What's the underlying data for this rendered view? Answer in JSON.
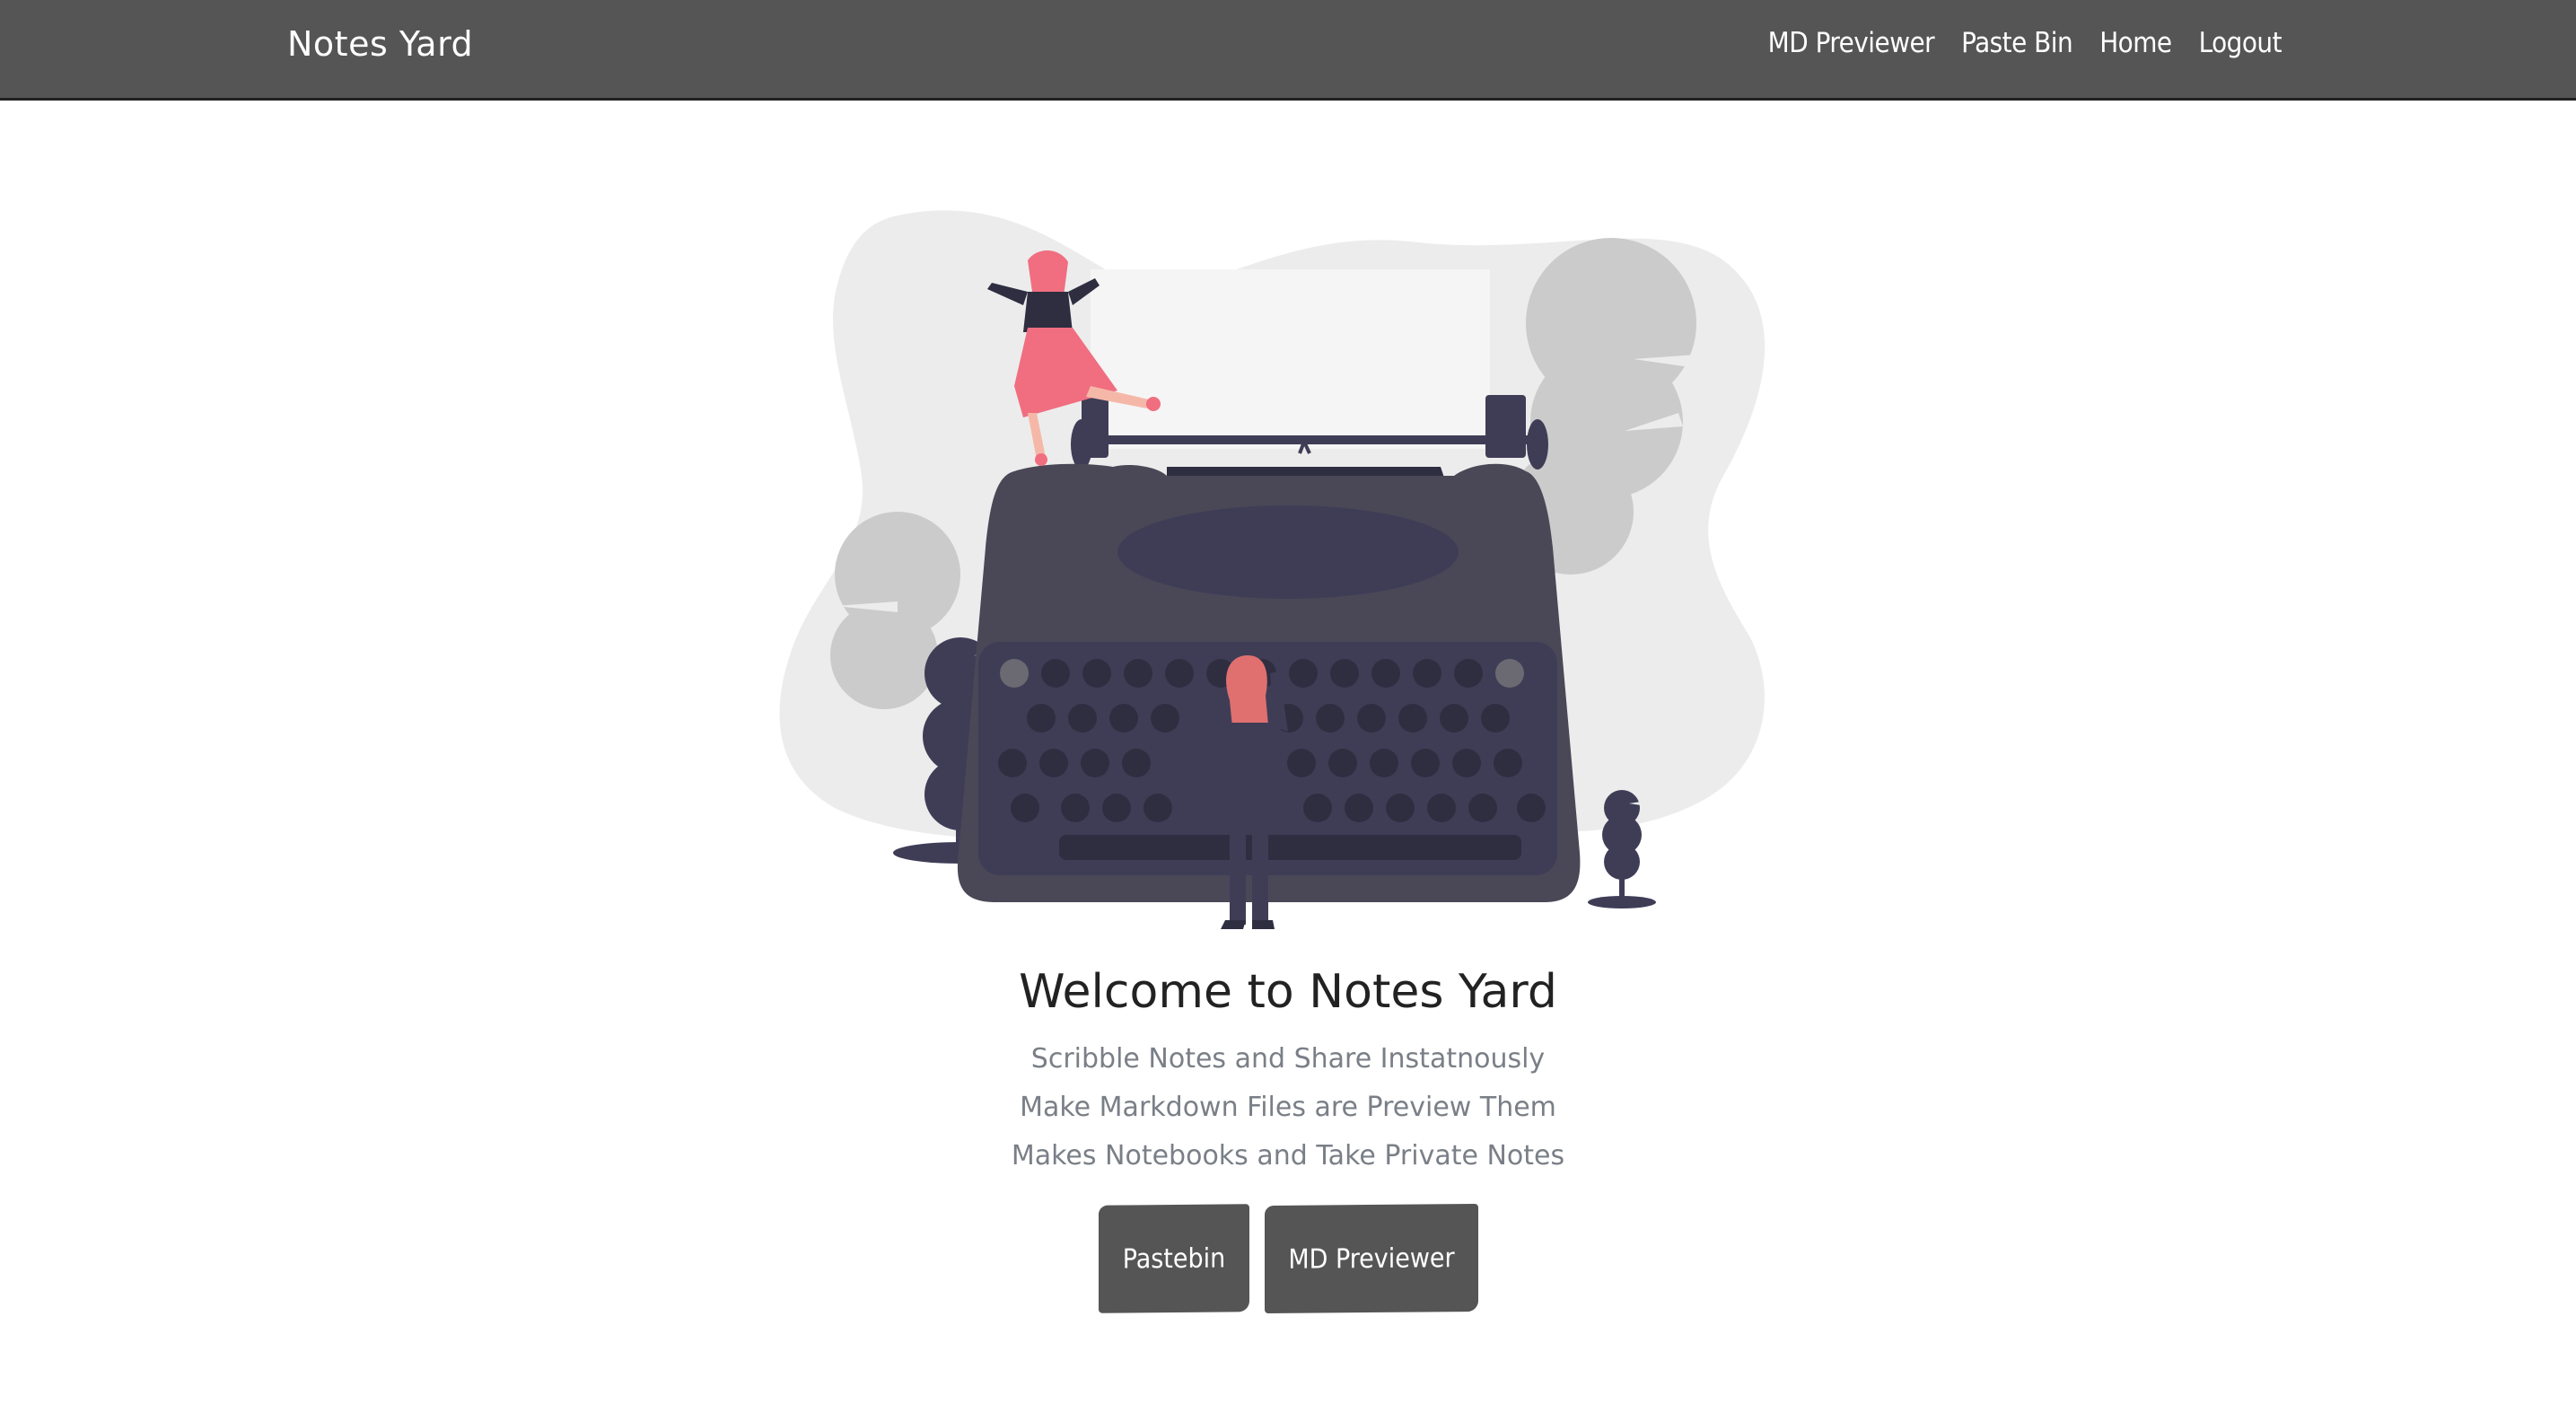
{
  "navbar": {
    "brand": "Notes Yard",
    "links": [
      "MD Previewer",
      "Paste Bin",
      "Home",
      "Logout"
    ],
    "background": "#555555"
  },
  "hero": {
    "illustration_icon": "typewriter-illustration",
    "title": "Welcome to Notes Yard",
    "lines": [
      "Scribble Notes and Share Instatnously",
      "Make Markdown Files are Preview Them",
      "Makes Notebooks and Take Private Notes"
    ],
    "buttons": [
      "Pastebin",
      "MD Previewer"
    ],
    "accent": "#f06e80"
  }
}
